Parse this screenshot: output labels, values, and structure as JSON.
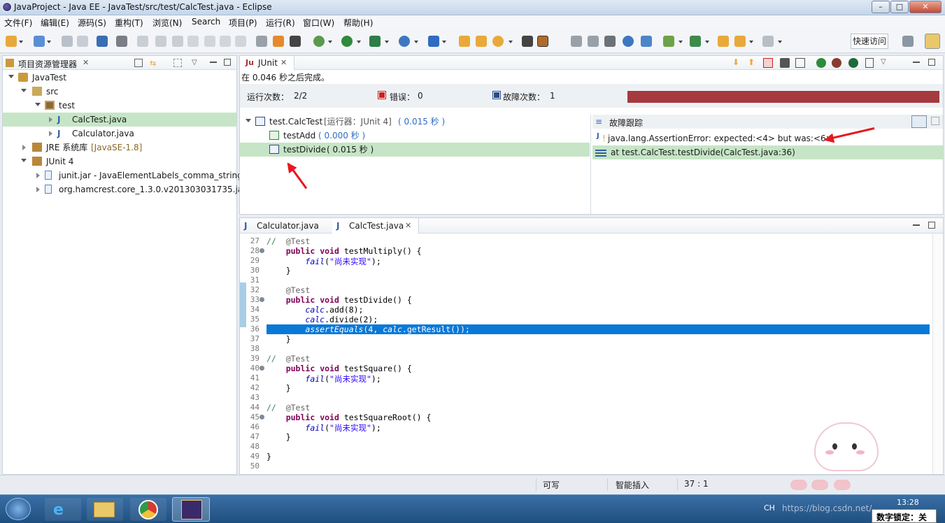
{
  "window": {
    "title": "JavaProject - Java EE - JavaTest/src/test/CalcTest.java - Eclipse",
    "min_label": "–",
    "max_label": "□",
    "close_label": "✕"
  },
  "menu": [
    "文件(F)",
    "编辑(E)",
    "源码(S)",
    "重构(T)",
    "浏览(N)",
    "Search",
    "项目(P)",
    "运行(R)",
    "窗口(W)",
    "帮助(H)"
  ],
  "toolbar": {
    "quick_access": "快速访问"
  },
  "explorer": {
    "title": "项目资源管理器",
    "close": "✕",
    "items": [
      {
        "label": "JavaTest",
        "icon": "project-icon"
      },
      {
        "label": "src",
        "icon": "source-folder-icon"
      },
      {
        "label": "test",
        "icon": "package-icon"
      },
      {
        "label": "CalcTest.java",
        "icon": "java-file-icon"
      },
      {
        "label": "Calculator.java",
        "icon": "java-file-icon"
      },
      {
        "label": "JRE 系统库",
        "suffix": "[JavaSE-1.8]",
        "icon": "library-icon"
      },
      {
        "label": "JUnit 4",
        "icon": "library-icon"
      },
      {
        "label": "junit.jar - JavaElementLabels_comma_string=",
        "icon": "jar-icon"
      },
      {
        "label": "org.hamcrest.core_1.3.0.v201303031735.jar",
        "icon": "jar-icon"
      }
    ]
  },
  "junit": {
    "tab": "JUnit",
    "close": "✕",
    "finished": "在 0.046 秒之后完成。",
    "runs_label": "运行次数：",
    "runs_value": "2/2",
    "errors_label": "错误：",
    "errors_value": "0",
    "failures_label": "故障次数：",
    "failures_value": "1",
    "progress": 1.0,
    "status_color": "#a5393d",
    "tree": [
      {
        "label": "test.CalcTest",
        "suffix": "[运行器：JUnit 4]",
        "time": "( 0.015 秒 )"
      },
      {
        "label": "testAdd",
        "time": "( 0.000 秒 )"
      },
      {
        "label": "testDivide",
        "time": "( 0.015 秒 )"
      }
    ],
    "failure_trace": {
      "title": "故障跟踪",
      "lines": [
        "java.lang.AssertionError: expected:<4> but was:<6>",
        "at test.CalcTest.testDivide(CalcTest.java:36)"
      ]
    }
  },
  "editor": {
    "tabs": [
      "Calculator.java",
      "CalcTest.java"
    ],
    "close": "✕",
    "highlighted_line": 36,
    "lines": [
      {
        "n": "27",
        "text": "//  @Test"
      },
      {
        "n": "28",
        "text": "    public void testMultiply() {"
      },
      {
        "n": "29",
        "text": "        fail(\"尚未实现\");"
      },
      {
        "n": "30",
        "text": "    }"
      },
      {
        "n": "31",
        "text": ""
      },
      {
        "n": "32",
        "text": "    @Test"
      },
      {
        "n": "33",
        "text": "    public void testDivide() {"
      },
      {
        "n": "34",
        "text": "        calc.add(8);"
      },
      {
        "n": "35",
        "text": "        calc.divide(2);"
      },
      {
        "n": "36",
        "text": "        assertEquals(4, calc.getResult());"
      },
      {
        "n": "37",
        "text": "    }"
      },
      {
        "n": "38",
        "text": ""
      },
      {
        "n": "39",
        "text": "//  @Test"
      },
      {
        "n": "40",
        "text": "    public void testSquare() {"
      },
      {
        "n": "41",
        "text": "        fail(\"尚未实现\");"
      },
      {
        "n": "42",
        "text": "    }"
      },
      {
        "n": "43",
        "text": ""
      },
      {
        "n": "44",
        "text": "//  @Test"
      },
      {
        "n": "45",
        "text": "    public void testSquareRoot() {"
      },
      {
        "n": "46",
        "text": "        fail(\"尚未实现\");"
      },
      {
        "n": "47",
        "text": "    }"
      },
      {
        "n": "48",
        "text": ""
      },
      {
        "n": "49",
        "text": "}"
      },
      {
        "n": "50",
        "text": ""
      }
    ]
  },
  "status": {
    "writable": "可写",
    "insert_mode": "智能插入",
    "position": "37 : 1"
  },
  "taskbar": {
    "clock": "13:28",
    "lock": "数字锁定：关",
    "ime": "CH",
    "watermark": "https://blog.csdn.net/..."
  }
}
